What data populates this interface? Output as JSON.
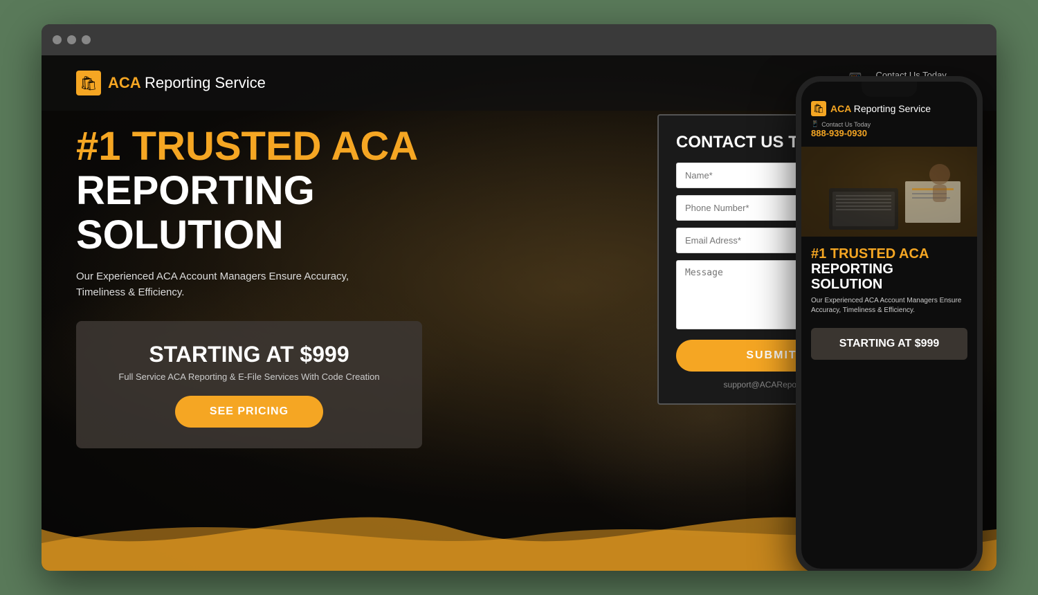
{
  "browser": {
    "dots": [
      "dot1",
      "dot2",
      "dot3"
    ]
  },
  "site": {
    "logo": {
      "icon": "🛍",
      "text_bold": "ACA",
      "text_regular": "Reporting Service"
    },
    "header": {
      "contact_label": "Contact Us Today",
      "phone": "888-939-0930"
    },
    "hero": {
      "title_line1": "#1 TRUSTED ACA",
      "title_line2": "REPORTING SOLUTION",
      "subtitle_line1": "Our Experienced ACA Account Managers Ensure Accuracy,",
      "subtitle_line2": "Timeliness & Efficiency."
    },
    "pricing_box": {
      "title": "STARTING AT $999",
      "subtitle": "Full Service ACA Reporting & E-File Services With Code Creation",
      "button": "SEE PRICING"
    },
    "contact_form": {
      "title": "CONTACT US TODAY!",
      "name_placeholder": "Name*",
      "phone_placeholder": "Phone Number*",
      "email_placeholder": "Email Adress*",
      "message_placeholder": "Message",
      "submit_label": "SUBMIT",
      "support_email": "support@ACAReporting..."
    },
    "mobile": {
      "logo_bold": "ACA",
      "logo_regular": "Reporting Service",
      "contact_label": "Contact Us Today",
      "phone": "888-939-0930",
      "title_line1": "#1 TRUSTED ACA",
      "title_line2": "REPORTING SOLUTION",
      "desc": "Our Experienced ACA Account Managers Ensure Accuracy, Timeliness & Efficiency.",
      "pricing_title": "STARTING AT $999"
    }
  },
  "colors": {
    "orange": "#f5a623",
    "dark": "#1a1a1a",
    "white": "#ffffff"
  }
}
